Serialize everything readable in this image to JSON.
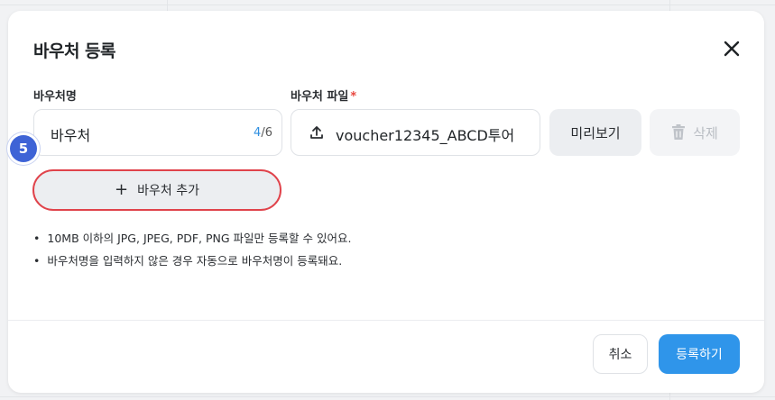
{
  "modal": {
    "title": "바우처 등록"
  },
  "form": {
    "name_label": "바우처명",
    "name_value": "바우처",
    "name_count_current": "4",
    "name_count_sep": "/",
    "name_count_max": "6",
    "file_label": "바우처 파일",
    "required_mark": "*",
    "file_name": "voucher12345_ABCD투어",
    "preview_label": "미리보기",
    "delete_label": "삭제",
    "add_label": "바우처 추가"
  },
  "notes": [
    "10MB 이하의 JPG, JPEG, PDF, PNG 파일만 등록할 수 있어요.",
    "바우처명을 입력하지 않은 경우 자동으로 바우처명이 등록돼요."
  ],
  "footer": {
    "cancel_label": "취소",
    "submit_label": "등록하기"
  },
  "step_badge": "5",
  "colors": {
    "accent": "#2f95ea",
    "counter": "#2f8fe0",
    "highlight_border": "#e0434b",
    "badge": "#3e63d6"
  },
  "icons": [
    "close-icon",
    "upload-icon",
    "trash-icon",
    "plus-icon"
  ]
}
